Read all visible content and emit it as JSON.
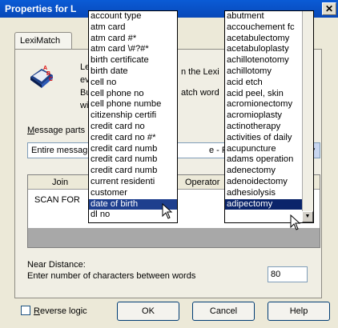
{
  "window": {
    "title": "Properties for L",
    "close": "✕"
  },
  "tab": {
    "label": "LexiMatch"
  },
  "description": {
    "line1": "Le",
    "line1_tail": "n the Lexi",
    "line2": "ev",
    "line3": "Bu",
    "line3_tail": "atch word",
    "line4": "wi"
  },
  "message_parts": {
    "label_u": "M",
    "label_rest": "essage parts",
    "selected": "Entire messag",
    "selected_tail": "e - Persona"
  },
  "grid": {
    "headers": {
      "join": "Join",
      "operator": "Operator"
    },
    "rows": [
      {
        "join": "SCAN FOR"
      }
    ]
  },
  "near": {
    "label": "Near Distance:",
    "sub": "Enter number of characters between words",
    "value": "80"
  },
  "reverse": {
    "label_u": "R",
    "label_rest": "everse logic"
  },
  "buttons": {
    "ok": "OK",
    "cancel": "Cancel",
    "help": "Help"
  },
  "list_left": [
    "account type",
    "atm card",
    "atm card #*",
    "atm card \\#?#*",
    "birth certificate",
    "birth date",
    "cell no",
    "cell phone no",
    "cell phone numbe",
    "citizenship certifi",
    "credit card no",
    "credit card no #*",
    "credit card numb",
    "credit card numb",
    "credit card numb",
    "current residenti",
    "customer",
    "date of birth",
    "dl no"
  ],
  "list_left_selected": "date of birth",
  "list_right": [
    "abutment",
    "accouchement fc",
    "acetabulectomy",
    "acetabuloplasty",
    "achillotenotomy",
    "achillotomy",
    "acid etch",
    "acid peel, skin",
    "acromionectomy",
    "acromioplasty",
    "actinotherapy",
    "activities of daily",
    "acupuncture",
    "adams operation",
    "adenectomy",
    "adenoidectomy",
    "adhesiolysis",
    "adipectomy"
  ],
  "list_right_selected": "adipectomy"
}
